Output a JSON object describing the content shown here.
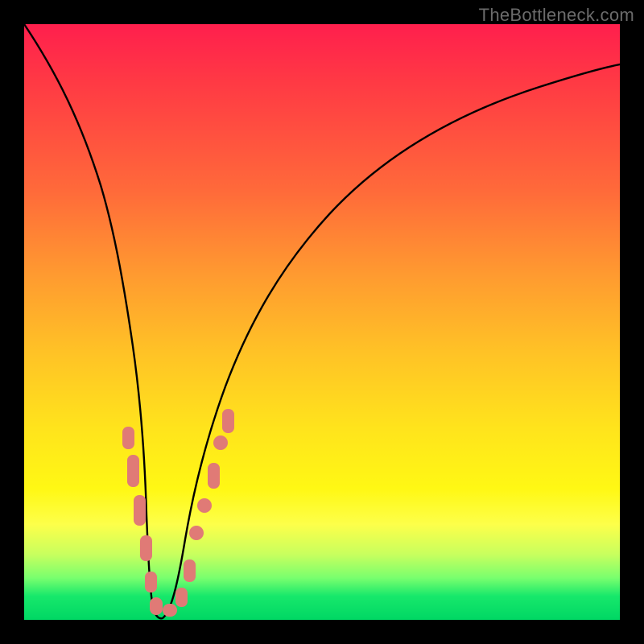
{
  "watermark": "TheBottleneck.com",
  "chart_data": {
    "type": "line",
    "title": "",
    "xlabel": "",
    "ylabel": "",
    "xlim": [
      0,
      100
    ],
    "ylim": [
      0,
      100
    ],
    "grid": false,
    "legend": false,
    "series": [
      {
        "name": "bottleneck-curve",
        "x": [
          0,
          2,
          4,
          6,
          8,
          10,
          12,
          14,
          16,
          18,
          19,
          20,
          21,
          22,
          23,
          24,
          26,
          28,
          30,
          34,
          38,
          44,
          52,
          62,
          74,
          88,
          100
        ],
        "y": [
          100,
          92,
          84,
          76,
          68,
          59,
          50,
          41,
          31,
          19,
          12,
          5,
          1,
          0,
          1,
          5,
          12,
          19,
          25,
          35,
          43,
          53,
          63,
          72,
          79,
          85,
          88
        ]
      }
    ],
    "optimal_marker_cluster": {
      "note": "salmon rounded dots near the curve minimum",
      "points": [
        {
          "x": 16.0,
          "y": 32
        },
        {
          "x": 16.5,
          "y": 28
        },
        {
          "x": 17.5,
          "y": 22
        },
        {
          "x": 18.0,
          "y": 18
        },
        {
          "x": 19.0,
          "y": 12
        },
        {
          "x": 19.5,
          "y": 8
        },
        {
          "x": 20.5,
          "y": 3
        },
        {
          "x": 21.5,
          "y": 1
        },
        {
          "x": 22.5,
          "y": 1
        },
        {
          "x": 23.5,
          "y": 4
        },
        {
          "x": 24.5,
          "y": 8
        },
        {
          "x": 25.0,
          "y": 12
        },
        {
          "x": 26.0,
          "y": 18
        },
        {
          "x": 27.0,
          "y": 22
        },
        {
          "x": 28.0,
          "y": 28
        },
        {
          "x": 28.5,
          "y": 32
        }
      ]
    },
    "background_gradient_stops": [
      {
        "pct": 0,
        "color": "#ff1f4d"
      },
      {
        "pct": 28,
        "color": "#ff6a3a"
      },
      {
        "pct": 55,
        "color": "#ffc226"
      },
      {
        "pct": 78,
        "color": "#fff814"
      },
      {
        "pct": 93,
        "color": "#78ff6e"
      },
      {
        "pct": 100,
        "color": "#00d764"
      }
    ]
  }
}
